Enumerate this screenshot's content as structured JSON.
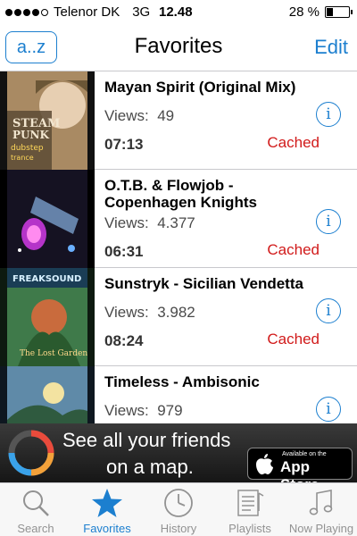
{
  "status_bar": {
    "carrier": "Telenor DK",
    "network": "3G",
    "time": "12.48",
    "battery": "28 %",
    "battery_level": 0.28
  },
  "nav": {
    "sort_button": "a..z",
    "title": "Favorites",
    "edit_button": "Edit"
  },
  "list": {
    "views_label": "Views:",
    "items": [
      {
        "title": "Mayan Spirit (Original Mix)",
        "views": "49",
        "duration": "07:13",
        "status": "Cached",
        "art": "steampunk-dubstep-cover"
      },
      {
        "title": "O.T.B. & Flowjob - Copenhagen Knights",
        "views": "4.377",
        "duration": "06:31",
        "status": "Cached",
        "art": "glass-bottle-cover"
      },
      {
        "title": "Sunstryk - Sicilian Vendetta",
        "views": "3.982",
        "duration": "08:24",
        "status": "Cached",
        "art": "lost-garden-cover"
      },
      {
        "title": "Timeless - Ambisonic",
        "views": "979",
        "duration": "",
        "status": "",
        "art": "fantasy-landscape-cover"
      }
    ]
  },
  "ad": {
    "line1": "See all your friends",
    "line2": "on a map.",
    "badge_small": "Available on the",
    "badge_big": "App Store"
  },
  "tabs": [
    {
      "label": "Search",
      "icon": "search-icon",
      "active": false
    },
    {
      "label": "Favorites",
      "icon": "star-icon",
      "active": true
    },
    {
      "label": "History",
      "icon": "clock-icon",
      "active": false
    },
    {
      "label": "Playlists",
      "icon": "playlist-icon",
      "active": false
    },
    {
      "label": "Now Playing",
      "icon": "music-note-icon",
      "active": false
    }
  ],
  "colors": {
    "accent": "#1c7fcf",
    "cached": "#d11a1a"
  }
}
